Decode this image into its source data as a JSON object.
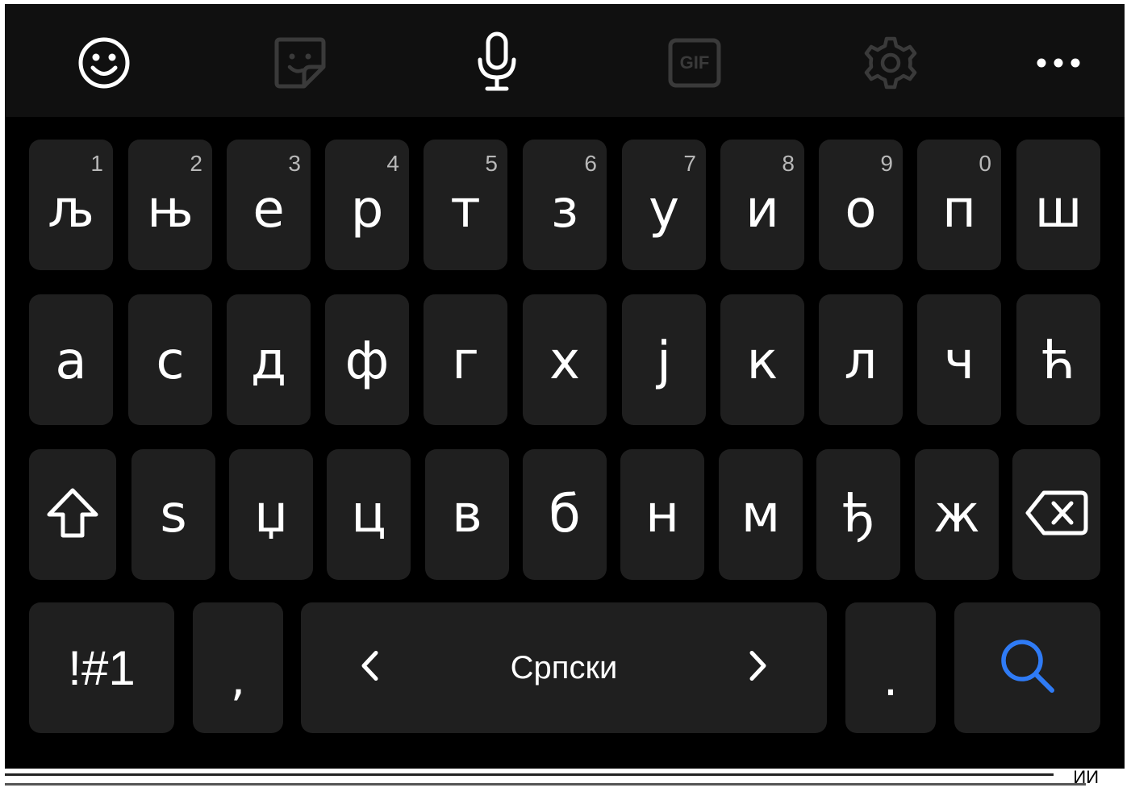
{
  "toolbar": {
    "items": [
      {
        "icon": "emoji-icon"
      },
      {
        "icon": "sticker-icon"
      },
      {
        "icon": "microphone-icon"
      },
      {
        "icon": "gif-icon",
        "label": "GIF"
      },
      {
        "icon": "gear-icon"
      },
      {
        "icon": "more-icon"
      }
    ]
  },
  "keys": {
    "row1": [
      {
        "char": "љ",
        "hint": "1"
      },
      {
        "char": "њ",
        "hint": "2"
      },
      {
        "char": "е",
        "hint": "3"
      },
      {
        "char": "р",
        "hint": "4"
      },
      {
        "char": "т",
        "hint": "5"
      },
      {
        "char": "з",
        "hint": "6"
      },
      {
        "char": "у",
        "hint": "7"
      },
      {
        "char": "и",
        "hint": "8"
      },
      {
        "char": "о",
        "hint": "9"
      },
      {
        "char": "п",
        "hint": "0"
      },
      {
        "char": "ш",
        "hint": ""
      }
    ],
    "row2": [
      "а",
      "с",
      "д",
      "ф",
      "г",
      "х",
      "ј",
      "к",
      "л",
      "ч",
      "ћ"
    ],
    "row3": [
      "ѕ",
      "џ",
      "ц",
      "в",
      "б",
      "н",
      "м",
      "ђ",
      "ж"
    ],
    "row4": {
      "symbols": "!#1",
      "comma": ",",
      "space": "Српски",
      "period": "."
    }
  },
  "colors": {
    "keyboard_bg": "#000000",
    "toolbar_bg": "#101010",
    "key_bg": "#1f1f1f",
    "toolbar_icon": "#ffffff",
    "toolbar_icon_dim": "#3a3a3a",
    "search_accent": "#2f7bf5"
  },
  "bottom_fragment": "ИИ"
}
